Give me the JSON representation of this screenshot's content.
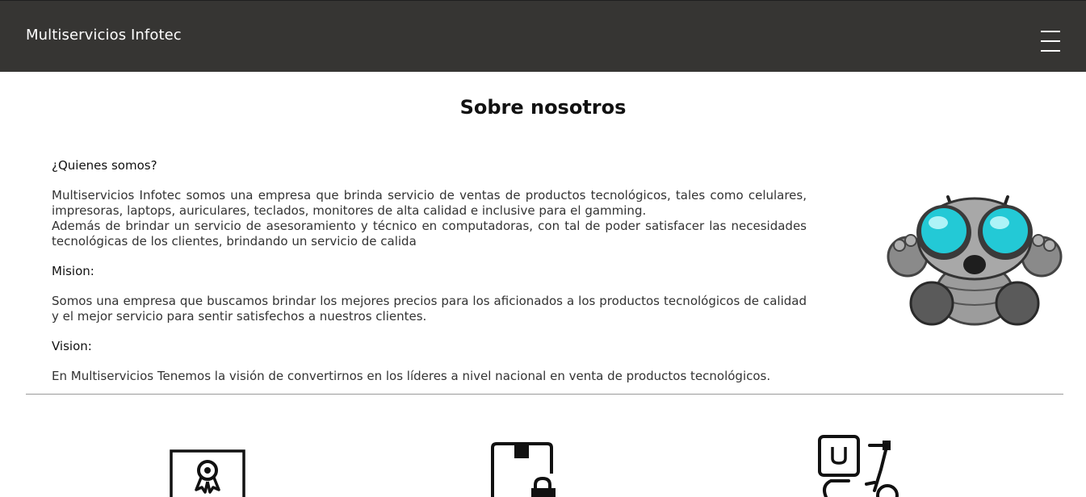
{
  "navbar": {
    "brand": "Multiservicios Infotec",
    "menu_icon": "hamburger-menu-icon"
  },
  "about": {
    "title": "Sobre nosotros",
    "who_heading": "¿Quienes somos?",
    "who_text_1": "Multiservicios Infotec somos una empresa que brinda servicio de ventas de productos tecnológicos, tales como celulares, impresoras, laptops, auriculares, teclados, monitores de alta calidad e inclusive para el gamming.",
    "who_text_2": "Además de brindar un servicio de asesoramiento y técnico en computadoras, con tal de poder satisfacer las necesidades tecnológicas de los clientes, brindando un servicio de calida",
    "mission_heading": "Mision:",
    "mission_text": "Somos una empresa que buscamos brindar los mejores precios para los aficionados a los productos tecnológicos de calidad y el mejor servicio para sentir satisfechos a nuestros clientes.",
    "vision_heading": "Vision:",
    "vision_text": "En Multiservicios Tenemos la visión de convertirnos en los líderes a nivel nacional en venta de productos tecnológicos."
  },
  "mascot_icon": "robot-mascot-icon",
  "features": [
    {
      "icon": "certificate-icon"
    },
    {
      "icon": "secure-phone-icon"
    },
    {
      "icon": "delivery-scooter-icon"
    }
  ]
}
